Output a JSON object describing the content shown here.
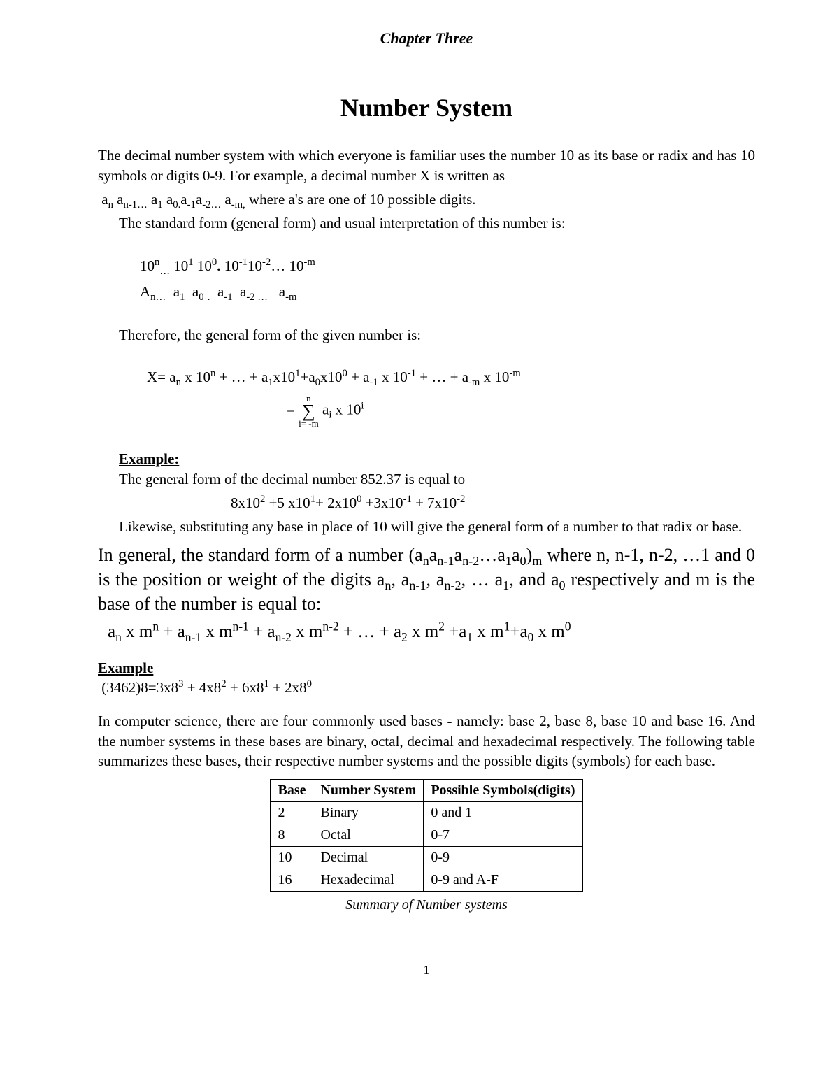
{
  "chapter": "Chapter Three",
  "title": "Number System",
  "intro1": "The decimal number system with which everyone is familiar uses the number 10 as its base or radix and has 10 symbols or digits 0-9.  For example, a decimal number X is written as",
  "intro2_prefix": " a",
  "intro2_rest": " where a's are one of 10 possible digits.",
  "intro3": "The standard form (general form) and usual interpretation of this number is:",
  "powers_line": "10ⁿ… 10¹ 10⁰. 10⁻¹10⁻²… 10⁻ᵐ",
  "coeffs_line": "Aₙ…  a₁  a₀ .  a₋₁  a₋₂ …   a₋ₘ",
  "therefore": "Therefore, the general form of the given number is:",
  "x_line": "X= aₙ x 10ⁿ + … + a₁x10¹+a₀x10⁰ + a₋₁ x 10⁻¹ + … + a₋ₘ x 10⁻ᵐ",
  "sum_top": "n",
  "sum_bot": "i= -m",
  "sum_rhs": " aᵢ x 10ⁱ",
  "example1_label": "Example:",
  "example1_text": "The general form of the decimal number 852.37 is equal to",
  "example1_formula": "8x10² +5 x10¹+ 2x10⁰ +3x10⁻¹ + 7x10⁻²",
  "likewise": "Likewise, substituting any base in place of 10 will give the general form of a number to that radix or base.",
  "general1": "In general, the standard form of a number (aₙaₙ₋₁aₙ₋₂…a₁a₀)ₘ where n, n-1, n-2, …1 and 0 is the position or weight of the digits aₙ, aₙ₋₁, aₙ₋₂, … a₁, and a₀ respectively and m is the base of the number is equal to:",
  "general_formula": "aₙ x mⁿ + aₙ₋₁ x mⁿ⁻¹ + aₙ₋₂ x mⁿ⁻² + … + a₂ x m² +a₁ x m¹+a₀ x m⁰",
  "example2_label": "Example",
  "example2_formula": " (3462)8=3x8³ + 4x8² + 6x8¹ + 2x8⁰",
  "cs_para": "In computer science, there are four commonly used bases - namely: base 2, base 8, base 10 and base 16. And the number systems in these bases are binary, octal, decimal and hexadecimal respectively. The following table summarizes these bases, their respective number systems and the possible digits (symbols) for each base.",
  "table": {
    "headers": [
      "Base",
      "Number System",
      "Possible Symbols(digits)"
    ],
    "rows": [
      [
        "2",
        "Binary",
        "0 and 1"
      ],
      [
        "8",
        "Octal",
        "0-7"
      ],
      [
        "10",
        "Decimal",
        "0-9"
      ],
      [
        "16",
        "Hexadecimal",
        "0-9 and A-F"
      ]
    ],
    "caption": "Summary of Number systems"
  },
  "page_num": "1",
  "chart_data": {
    "type": "table",
    "title": "Summary of Number systems",
    "columns": [
      "Base",
      "Number System",
      "Possible Symbols(digits)"
    ],
    "rows": [
      {
        "Base": 2,
        "Number System": "Binary",
        "Possible Symbols(digits)": "0 and 1"
      },
      {
        "Base": 8,
        "Number System": "Octal",
        "Possible Symbols(digits)": "0-7"
      },
      {
        "Base": 10,
        "Number System": "Decimal",
        "Possible Symbols(digits)": "0-9"
      },
      {
        "Base": 16,
        "Number System": "Hexadecimal",
        "Possible Symbols(digits)": "0-9 and A-F"
      }
    ]
  }
}
